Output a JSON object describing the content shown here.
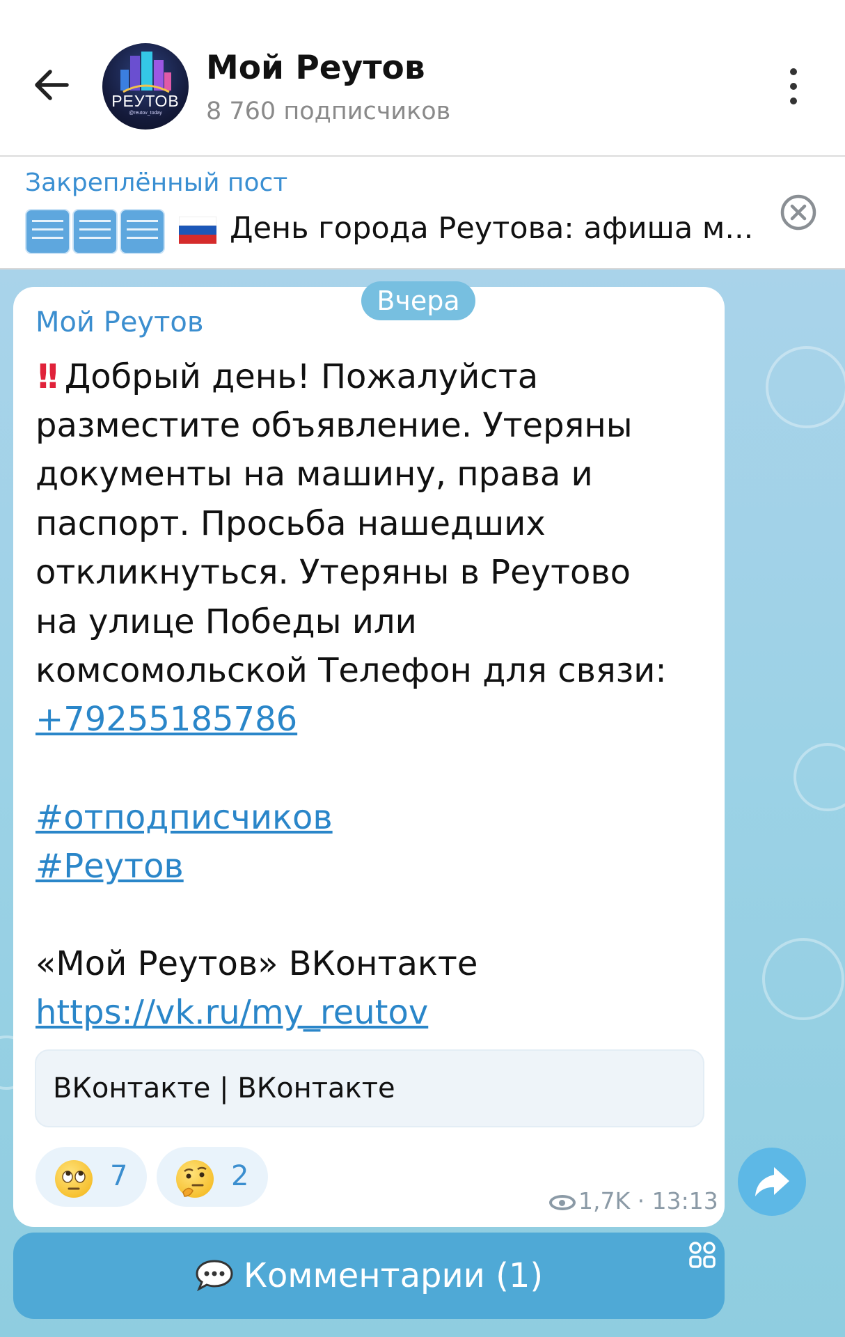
{
  "header": {
    "channel_name": "Мой Реутов",
    "subscribers": "8 760 подписчиков",
    "avatar_text": "РЕУТОВ",
    "avatar_subtext": "@reutov_today"
  },
  "pinned": {
    "label": "Закреплённый пост",
    "text": "День города Реутова: афиша м..."
  },
  "message": {
    "date_pill": "Вчера",
    "sender": "Мой Реутов",
    "line1": "Добрый день! Пожалуйста",
    "line2": "разместите объявление. Утеряны",
    "line3": "документы на машину, права и",
    "line4": "паспорт. Просьба нашедших",
    "line5": "откликнуться. Утеряны в Реутово",
    "line6": "на улице Победы или",
    "line7": "комсомольской Телефон для связи:",
    "phone": "+79255185786",
    "hashtag1": "#отподписчиков",
    "hashtag2": "#Реутов",
    "vk_line": "«Мой Реутов»  ВКонтакте",
    "vk_url": "https://vk.ru/my_reutov",
    "preview_title": "ВКонтакте | ВКонтакте",
    "reactions": [
      {
        "emoji": "🙄",
        "count": "7"
      },
      {
        "emoji": "🤔",
        "count": "2"
      }
    ],
    "views": "1,7K",
    "time": "13:13",
    "meta_sep": " · "
  },
  "comments": {
    "label": "Комментарии (1)"
  },
  "colors": {
    "accent": "#3b8ecf",
    "link": "#2a86c9",
    "chat_bg": "#9cd2e6",
    "comments_bar": "#4fa9d6",
    "share_button": "#5db8e6"
  }
}
